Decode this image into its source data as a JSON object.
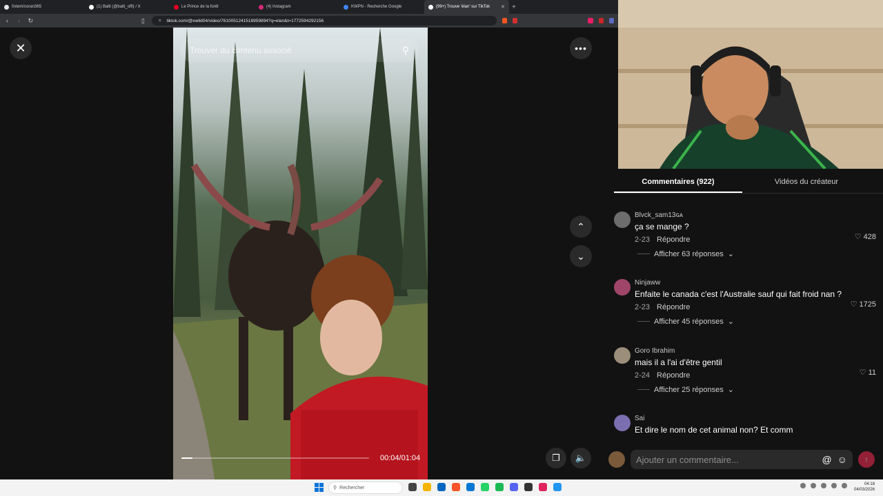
{
  "browser": {
    "tabs": [
      {
        "label": "0xtem/coran365",
        "color": "#e8e8e8"
      },
      {
        "label": "(1) Balti (@balti_offi) / X",
        "color": "#ffffff"
      },
      {
        "label": "Le Prince de la forêt",
        "color": "#e60023"
      },
      {
        "label": "(4) Instagram",
        "color": "#d62976"
      },
      {
        "label": "KWPN - Recherche Google",
        "color": "#4285f4"
      },
      {
        "label": "(99+) Trouve 'élan' sur TikTok",
        "color": "#ffffff",
        "active": true
      }
    ],
    "url": "tiktok.com/@xwild04/video/7610051241518959894?q=elan&t=1772594292156"
  },
  "video": {
    "search_placeholder": "Trouver du contenu associé",
    "timecode": "00:04/01:04",
    "progress": 0.06
  },
  "comments_panel": {
    "tabs": [
      {
        "label": "Commentaires (922)",
        "active": true
      },
      {
        "label": "Vidéos du créateur",
        "active": false
      }
    ],
    "comments": [
      {
        "user": "Blvck_sam13ɢᴀ",
        "text": "ça se mange ?",
        "date": "2-23",
        "reply_label": "Répondre",
        "likes": "428",
        "replies": "Afficher 63 réponses",
        "avatar_color": "#6d6d6d"
      },
      {
        "user": "Ninjaww",
        "text": "Enfaite le canada c'est l'Australie sauf qui fait froid nan ?",
        "date": "2-23",
        "reply_label": "Répondre",
        "likes": "1725",
        "replies": "Afficher 45 réponses",
        "avatar_color": "#a0456a"
      },
      {
        "user": "Goro Ibrahim",
        "text": "mais il a l'ai d'être gentil",
        "date": "2-24",
        "reply_label": "Répondre",
        "likes": "11",
        "replies": "Afficher 25 réponses",
        "avatar_color": "#9b8e7a"
      },
      {
        "user": "Sai",
        "text": "Et dire le nom de cet animal non? Et comm",
        "avatar_color": "#7b6fb0"
      }
    ],
    "composer_placeholder": "Ajouter un commentaire..."
  },
  "taskbar": {
    "search_label": "Rechercher",
    "time": "04:18",
    "date": "04/03/2026"
  }
}
